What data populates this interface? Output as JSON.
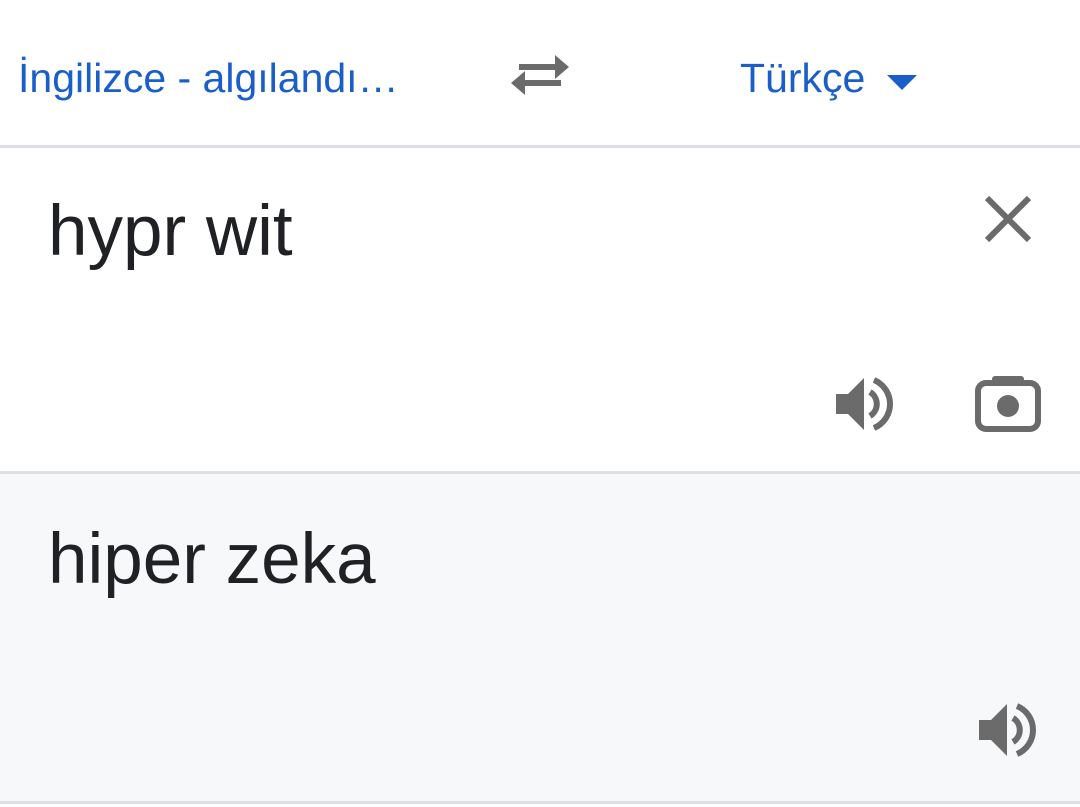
{
  "language_bar": {
    "source_language": "İngilizce - algılandı…",
    "target_language": "Türkçe",
    "swap_icon": "swap-arrows-icon",
    "dropdown_icon": "dropdown-arrow-icon"
  },
  "source": {
    "text": "hypr wit",
    "clear_icon": "close-icon",
    "speak_icon": "volume-icon",
    "camera_icon": "camera-icon"
  },
  "result": {
    "text": "hiper zeka",
    "speak_icon": "volume-icon"
  },
  "colors": {
    "accent": "#1a5fc9",
    "icon": "#6b6b6b",
    "text": "#202124",
    "result_background": "#f7f8fa",
    "divider": "#dcdfe3"
  }
}
